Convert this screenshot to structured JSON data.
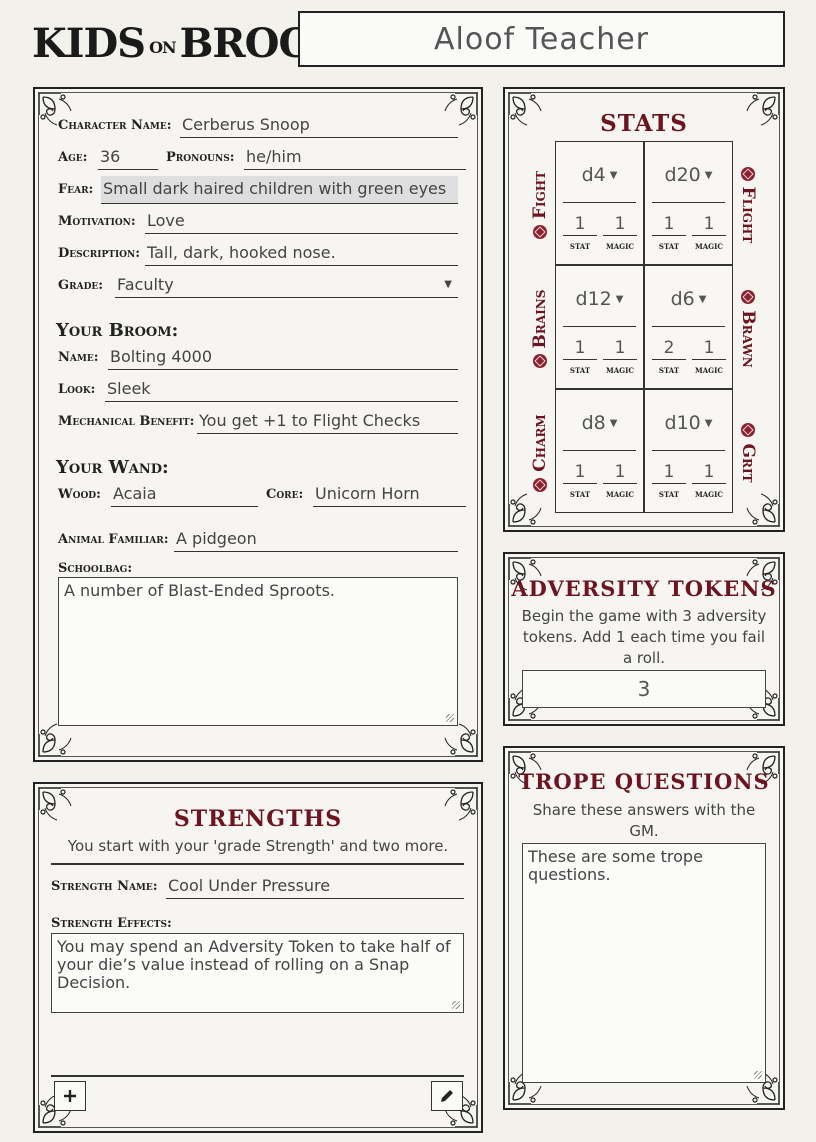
{
  "app": {
    "logo_part1": "KIDS",
    "logo_part2": "ON",
    "logo_part3": "BROOMS",
    "character_title": "Aloof Teacher"
  },
  "character": {
    "name_label": "Character Name:",
    "name": "Cerberus Snoop",
    "age_label": "Age:",
    "age": "36",
    "pronouns_label": "Pronouns:",
    "pronouns": "he/him",
    "fear_label": "Fear:",
    "fear": "Small dark haired children with green eyes",
    "motivation_label": "Motivation:",
    "motivation": "Love",
    "description_label": "Description:",
    "description": "Tall, dark, hooked nose.",
    "grade_label": "Grade:",
    "grade": "Faculty"
  },
  "broom": {
    "heading": "Your Broom:",
    "name_label": "Name:",
    "name": "Bolting 4000",
    "look_label": "Look:",
    "look": "Sleek",
    "benefit_label": "Mechanical Benefit:",
    "benefit": "You get +1 to Flight Checks"
  },
  "wand": {
    "heading": "Your Wand:",
    "wood_label": "Wood:",
    "wood": "Acaia",
    "core_label": "Core:",
    "core": "Unicorn Horn"
  },
  "familiar": {
    "label": "Animal Familiar:",
    "value": "A pidgeon"
  },
  "schoolbag": {
    "label": "Schoolbag:",
    "value": "A number of Blast-Ended Sproots."
  },
  "stats": {
    "heading": "STATS",
    "stat_label": "stat",
    "magic_label": "magic",
    "left_labels": [
      "Fight",
      "Brains",
      "Charm"
    ],
    "right_labels": [
      "Flight",
      "Brawn",
      "Grit"
    ],
    "rows": [
      [
        {
          "die": "d4",
          "stat": "1",
          "magic": "1"
        },
        {
          "die": "d20",
          "stat": "1",
          "magic": "1"
        }
      ],
      [
        {
          "die": "d12",
          "stat": "1",
          "magic": "1"
        },
        {
          "die": "d6",
          "stat": "2",
          "magic": "1"
        }
      ],
      [
        {
          "die": "d8",
          "stat": "1",
          "magic": "1"
        },
        {
          "die": "d10",
          "stat": "1",
          "magic": "1"
        }
      ]
    ]
  },
  "adversity": {
    "heading": "ADVERSITY TOKENS",
    "desc": "Begin the game with 3 adversity tokens. Add 1 each time you fail a roll.",
    "value": "3"
  },
  "trope": {
    "heading": "TROPE QUESTIONS",
    "desc": "Share these answers with the GM.",
    "value": "These are some trope questions."
  },
  "strengths": {
    "heading": "STRENGTHS",
    "desc": "You start with your 'grade Strength' and two more.",
    "name_label": "Strength Name:",
    "name": "Cool Under Pressure",
    "effects_label": "Strength Effects:",
    "effects": "You may spend an Adversity Token to take half of your die’s value instead of rolling on a Snap Decision.",
    "add_icon": "plus-icon",
    "edit_icon": "pencil-icon"
  },
  "colors": {
    "accent_red": "#6e1420",
    "die_red": "#8a2230",
    "page_bg": "#f3f1ec"
  }
}
